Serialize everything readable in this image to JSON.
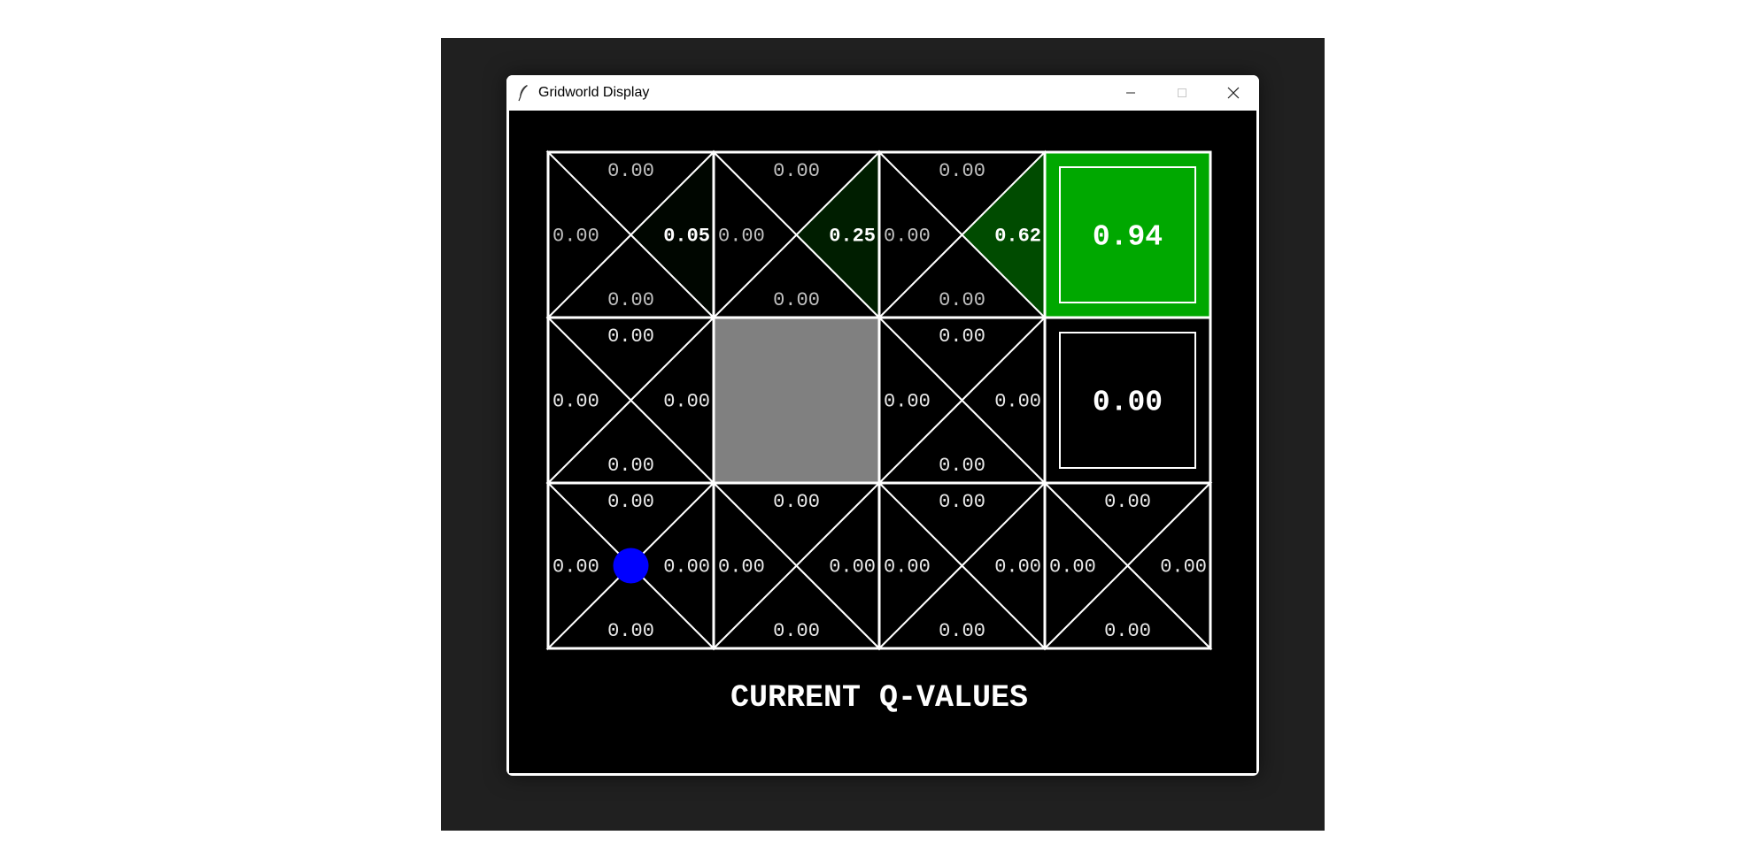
{
  "window": {
    "title": "Gridworld Display",
    "controls": {
      "minimize": "minimize",
      "maximize": "maximize",
      "close": "close"
    }
  },
  "caption": "CURRENT Q-VALUES",
  "colors": {
    "background": "#000000",
    "grid_lines": "#ffffff",
    "wall": "#808080",
    "positive_value_max": "#00a800",
    "agent": "#0000ff"
  },
  "grid": {
    "rows": 3,
    "cols": 4,
    "cells": [
      {
        "row": 0,
        "col": 0,
        "type": "q",
        "north": "0.00",
        "south": "0.00",
        "west": "0.00",
        "east": "0.05"
      },
      {
        "row": 0,
        "col": 1,
        "type": "q",
        "north": "0.00",
        "south": "0.00",
        "west": "0.00",
        "east": "0.25"
      },
      {
        "row": 0,
        "col": 2,
        "type": "q",
        "north": "0.00",
        "south": "0.00",
        "west": "0.00",
        "east": "0.62"
      },
      {
        "row": 0,
        "col": 3,
        "type": "terminal",
        "value": "0.94"
      },
      {
        "row": 1,
        "col": 0,
        "type": "q",
        "north": "0.00",
        "south": "0.00",
        "west": "0.00",
        "east": "0.00"
      },
      {
        "row": 1,
        "col": 1,
        "type": "wall"
      },
      {
        "row": 1,
        "col": 2,
        "type": "q",
        "north": "0.00",
        "south": "0.00",
        "west": "0.00",
        "east": "0.00"
      },
      {
        "row": 1,
        "col": 3,
        "type": "terminal",
        "value": "0.00"
      },
      {
        "row": 2,
        "col": 0,
        "type": "q",
        "north": "0.00",
        "south": "0.00",
        "west": "0.00",
        "east": "0.00",
        "agent": true
      },
      {
        "row": 2,
        "col": 1,
        "type": "q",
        "north": "0.00",
        "south": "0.00",
        "west": "0.00",
        "east": "0.00"
      },
      {
        "row": 2,
        "col": 2,
        "type": "q",
        "north": "0.00",
        "south": "0.00",
        "west": "0.00",
        "east": "0.00"
      },
      {
        "row": 2,
        "col": 3,
        "type": "q",
        "north": "0.00",
        "south": "0.00",
        "west": "0.00",
        "east": "0.00"
      }
    ]
  }
}
